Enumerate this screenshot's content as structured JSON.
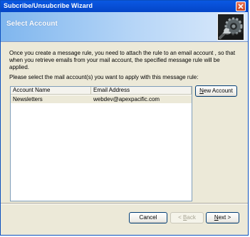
{
  "window": {
    "title": "Subcribe/Unsubcribe Wizard"
  },
  "header": {
    "title": "Select Account",
    "logo_icon": "gear-wrench-icon"
  },
  "body": {
    "intro": "Once you create a message rule, you need to attach the rule to an email account , so that when you retrieve emails from your mail account, the specified message rule will be applied.",
    "instruction": "Please select the mail account(s) you want to apply with this message rule:"
  },
  "accounts_list": {
    "columns": [
      "Account Name",
      "Email Address"
    ],
    "rows": [
      {
        "account_name": "Newsletters",
        "email": "webdev@apexpacific.com",
        "selected": true
      }
    ]
  },
  "buttons": {
    "new_account_hotkey": "N",
    "new_account_rest": "ew Account",
    "cancel": "Cancel",
    "back_hotkey": "B",
    "back_rest": "ack",
    "back_prefix": "< ",
    "next_hotkey": "N",
    "next_rest": "ext >"
  },
  "colors": {
    "title_bar": "#0a58e3",
    "header_gradient_start": "#7fb6ee",
    "dialog_bg": "#ece9d8",
    "selected_row": "#ece9d8"
  }
}
